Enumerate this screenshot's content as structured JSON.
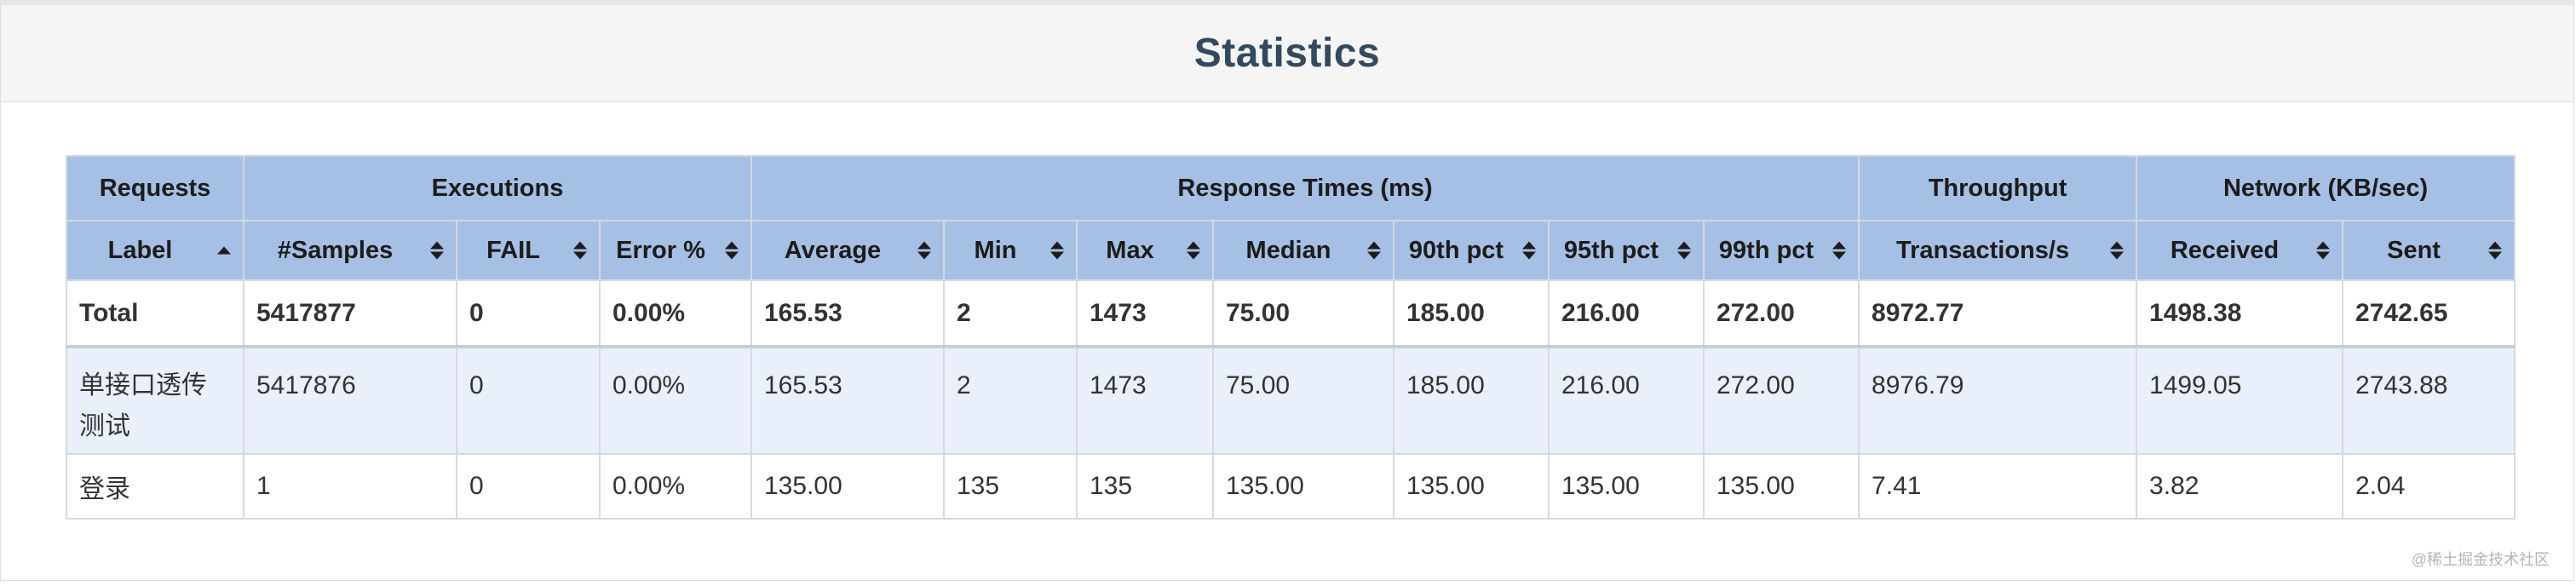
{
  "title": "Statistics",
  "table": {
    "group_headers": [
      "Requests",
      "Executions",
      "Response Times (ms)",
      "Throughput",
      "Network (KB/sec)"
    ],
    "columns": [
      "Label",
      "#Samples",
      "FAIL",
      "Error %",
      "Average",
      "Min",
      "Max",
      "Median",
      "90th pct",
      "95th pct",
      "99th pct",
      "Transactions/s",
      "Received",
      "Sent"
    ],
    "rows": [
      [
        "Total",
        "5417877",
        "0",
        "0.00%",
        "165.53",
        "2",
        "1473",
        "75.00",
        "185.00",
        "216.00",
        "272.00",
        "8972.77",
        "1498.38",
        "2742.65"
      ],
      [
        "单接口透传测试",
        "5417876",
        "0",
        "0.00%",
        "165.53",
        "2",
        "1473",
        "75.00",
        "185.00",
        "216.00",
        "272.00",
        "8976.79",
        "1499.05",
        "2743.88"
      ],
      [
        "登录",
        "1",
        "0",
        "0.00%",
        "135.00",
        "135",
        "135",
        "135.00",
        "135.00",
        "135.00",
        "135.00",
        "7.41",
        "3.82",
        "2.04"
      ]
    ]
  },
  "watermark": "@稀土掘金技术社区",
  "colors": {
    "header_bg": "#a6bfe4",
    "title": "#34495e",
    "row_alt": "#eaf0f9"
  }
}
